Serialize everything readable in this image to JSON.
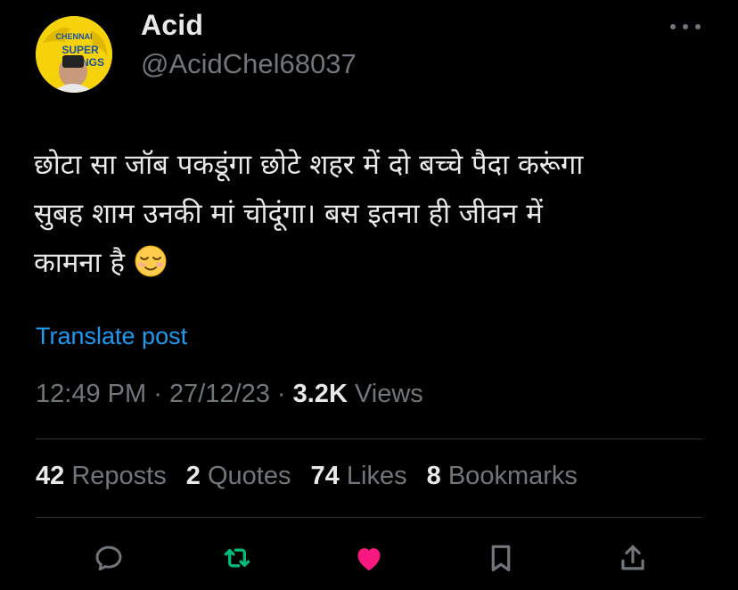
{
  "author": {
    "name": "Acid",
    "handle": "@AcidChel68037",
    "avatar_badge": "CHENNAI SUPER KINGS"
  },
  "tweet": {
    "lines": [
      "छोटा सा जॉब पकडूंगा छोटे शहर में दो बच्चे पैदा करूंगा",
      "सुबह शाम उनकी मां चोदूंगा। बस इतना ही जीवन में",
      "कामना है"
    ],
    "emoji_name": "relieved-face-emoji"
  },
  "translate_label": "Translate post",
  "meta": {
    "time": "12:49 PM",
    "sep1": "·",
    "date": "27/12/23",
    "sep2": "·",
    "views_count": "3.2K",
    "views_label": "Views"
  },
  "stats": {
    "reposts_count": "42",
    "reposts_label": "Reposts",
    "quotes_count": "2",
    "quotes_label": "Quotes",
    "likes_count": "74",
    "likes_label": "Likes",
    "bookmarks_count": "8",
    "bookmarks_label": "Bookmarks"
  },
  "actions": [
    "reply-icon",
    "repost-icon",
    "like-icon",
    "bookmark-icon",
    "share-icon"
  ],
  "colors": {
    "background": "#000000",
    "text": "#e7e9ea",
    "secondary": "#71767b",
    "link": "#1d9bf0",
    "repost_active": "#00ba7c",
    "like_active": "#f91880",
    "divider": "#2f3336"
  }
}
